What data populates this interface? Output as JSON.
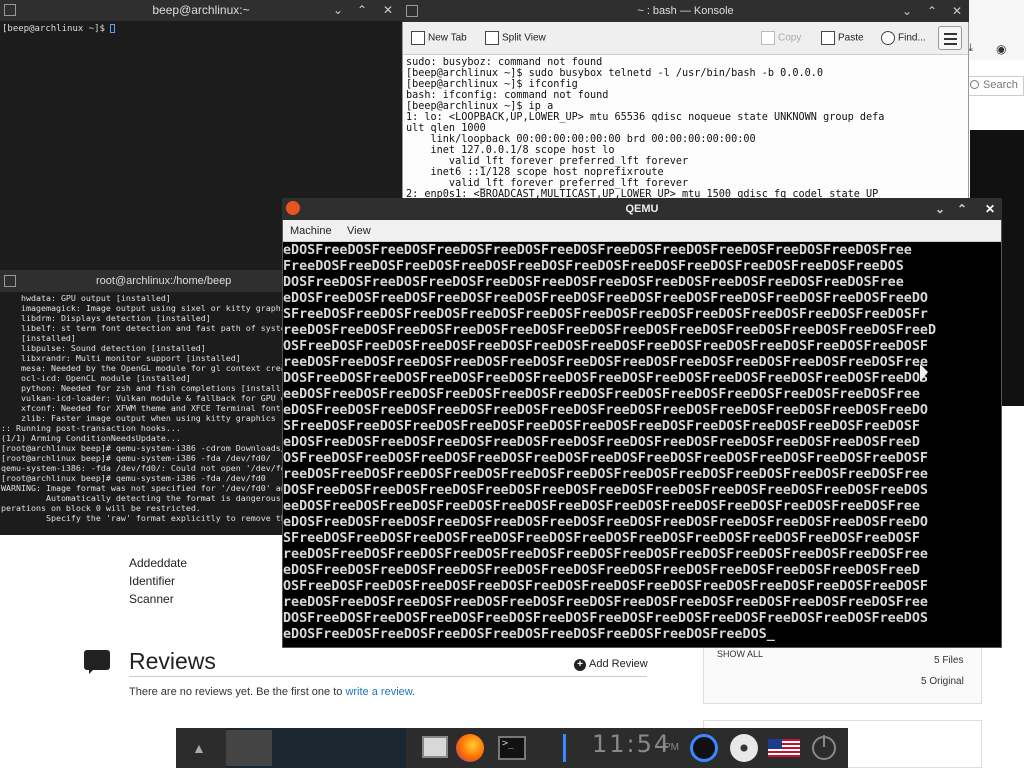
{
  "background_page": {
    "meta_items": [
      "Addeddate",
      "Identifier",
      "Scanner"
    ],
    "reviews_title": "Reviews",
    "add_review_label": "Add Review",
    "no_reviews_prefix": "There are no reviews yet. Be the first one to ",
    "no_reviews_link": "write a review",
    "no_reviews_suffix": ".",
    "show_all": "SHOW ALL",
    "files_count": "5 Files",
    "original_count": "5 Original",
    "search_placeholder": "Search"
  },
  "term1": {
    "title": "beep@archlinux:~",
    "prompt": "[beep@archlinux ~]$ "
  },
  "term2": {
    "title": "root@archlinux:/home/beep",
    "lines": [
      "    hwdata: GPU output [installed]",
      "    imagemagick: Image output using sixel or kitty graphi",
      "    libdrm: Displays detection [installed]",
      "    libelf: st term font detection and fast path of syste",
      "    [installed]",
      "    libpulse: Sound detection [installed]",
      "    libxrandr: Multi monitor support [installed]",
      "    mesa: Needed by the OpenGL module for gl context crea",
      "    ocl-icd: OpenCL module [installed]",
      "    python: Needed for zsh and fish completions [install",
      "    vulkan-icd-loader: Vulkan module & fallback for GPU o",
      "    xfconf: Needed for XFWM theme and XFCE Terminal font",
      "    zlib: Faster image output when using kitty graphics",
      ":: Running post-transaction hooks...",
      "(1/1) Arming ConditionNeedsUpdate...",
      "[root@archlinux beep]# qemu-system-i386 -cdrom Downloads/",
      "[root@archlinux beep]# qemu-system-i386 -fda /dev/fd0/",
      "qemu-system-i386: -fda /dev/fd0/: Could not open '/dev/fd",
      "[root@archlinux beep]# qemu-system-i386 -fda /dev/fd0",
      "WARNING: Image format was not specified for '/dev/fd0' an",
      "         Automatically detecting the format is dangerous",
      "perations on block 0 will be restricted.",
      "         Specify the 'raw' format explicitly to remove th"
    ]
  },
  "konsole": {
    "title": "~ : bash — Konsole",
    "toolbar": {
      "new_tab": "New Tab",
      "split_view": "Split View",
      "copy": "Copy",
      "paste": "Paste",
      "find": "Find..."
    },
    "lines": [
      "sudo: busyboz: command not found",
      "[beep@archlinux ~]$ sudo busybox telnetd -l /usr/bin/bash -b 0.0.0.0",
      "[beep@archlinux ~]$ ifconfig",
      "bash: ifconfig: command not found",
      "[beep@archlinux ~]$ ip a",
      "1: lo: <LOOPBACK,UP,LOWER_UP> mtu 65536 qdisc noqueue state UNKNOWN group defa",
      "ult qlen 1000",
      "    link/loopback 00:00:00:00:00:00 brd 00:00:00:00:00:00",
      "    inet 127.0.0.1/8 scope host lo",
      "       valid_lft forever preferred_lft forever",
      "    inet6 ::1/128 scope host noprefixroute",
      "       valid_lft forever preferred_lft forever",
      "2: enp0s1: <BROADCAST,MULTICAST,UP,LOWER_UP> mtu 1500 qdisc fq_codel state UP"
    ]
  },
  "qemu": {
    "title": "QEMU",
    "menu": [
      "Machine",
      "View"
    ],
    "screen_lines": [
      "eDOSFreeDOSFreeDOSFreeDOSFreeDOSFreeDOSFreeDOSFreeDOSFreeDOSFreeDOSFreeDOSFree",
      "FreeDOSFreeDOSFreeDOSFreeDOSFreeDOSFreeDOSFreeDOSFreeDOSFreeDOSFreeDOSFreeDOS",
      "DOSFreeDOSFreeDOSFreeDOSFreeDOSFreeDOSFreeDOSFreeDOSFreeDOSFreeDOSFreeDOSFree",
      "eDOSFreeDOSFreeDOSFreeDOSFreeDOSFreeDOSFreeDOSFreeDOSFreeDOSFreeDOSFreeDOSFreeDO",
      "SFreeDOSFreeDOSFreeDOSFreeDOSFreeDOSFreeDOSFreeDOSFreeDOSFreeDOSFreeDOSFreeDOSFr",
      "reeDOSFreeDOSFreeDOSFreeDOSFreeDOSFreeDOSFreeDOSFreeDOSFreeDOSFreeDOSFreeDOSFreeD",
      "OSFreeDOSFreeDOSFreeDOSFreeDOSFreeDOSFreeDOSFreeDOSFreeDOSFreeDOSFreeDOSFreeDOSF",
      "reeDOSFreeDOSFreeDOSFreeDOSFreeDOSFreeDOSFreeDOSFreeDOSFreeDOSFreeDOSFreeDOSFree",
      "DOSFreeDOSFreeDOSFreeDOSFreeDOSFreeDOSFreeDOSFreeDOSFreeDOSFreeDOSFreeDOSFreeDOS",
      "eeDOSFreeDOSFreeDOSFreeDOSFreeDOSFreeDOSFreeDOSFreeDOSFreeDOSFreeDOSFreeDOSFree",
      "eDOSFreeDOSFreeDOSFreeDOSFreeDOSFreeDOSFreeDOSFreeDOSFreeDOSFreeDOSFreeDOSFreeDO",
      "SFreeDOSFreeDOSFreeDOSFreeDOSFreeDOSFreeDOSFreeDOSFreeDOSFreeDOSFreeDOSFreeDOSF",
      "eDOSFreeDOSFreeDOSFreeDOSFreeDOSFreeDOSFreeDOSFreeDOSFreeDOSFreeDOSFreeDOSFreeD",
      "OSFreeDOSFreeDOSFreeDOSFreeDOSFreeDOSFreeDOSFreeDOSFreeDOSFreeDOSFreeDOSFreeDOSF",
      "reeDOSFreeDOSFreeDOSFreeDOSFreeDOSFreeDOSFreeDOSFreeDOSFreeDOSFreeDOSFreeDOSFree",
      "DOSFreeDOSFreeDOSFreeDOSFreeDOSFreeDOSFreeDOSFreeDOSFreeDOSFreeDOSFreeDOSFreeDOS",
      "eeDOSFreeDOSFreeDOSFreeDOSFreeDOSFreeDOSFreeDOSFreeDOSFreeDOSFreeDOSFreeDOSFree",
      "eDOSFreeDOSFreeDOSFreeDOSFreeDOSFreeDOSFreeDOSFreeDOSFreeDOSFreeDOSFreeDOSFreeDO",
      "SFreeDOSFreeDOSFreeDOSFreeDOSFreeDOSFreeDOSFreeDOSFreeDOSFreeDOSFreeDOSFreeDOSF",
      "reeDOSFreeDOSFreeDOSFreeDOSFreeDOSFreeDOSFreeDOSFreeDOSFreeDOSFreeDOSFreeDOSFree",
      "eDOSFreeDOSFreeDOSFreeDOSFreeDOSFreeDOSFreeDOSFreeDOSFreeDOSFreeDOSFreeDOSFreeD",
      "OSFreeDOSFreeDOSFreeDOSFreeDOSFreeDOSFreeDOSFreeDOSFreeDOSFreeDOSFreeDOSFreeDOSF",
      "reeDOSFreeDOSFreeDOSFreeDOSFreeDOSFreeDOSFreeDOSFreeDOSFreeDOSFreeDOSFreeDOSFree",
      "DOSFreeDOSFreeDOSFreeDOSFreeDOSFreeDOSFreeDOSFreeDOSFreeDOSFreeDOSFreeDOSFreeDOS",
      "eDOSFreeDOSFreeDOSFreeDOSFreeDOSFreeDOSFreeDOSFreeDOSFreeDOS_"
    ]
  },
  "taskbar": {
    "terminal_icon_text": ">_",
    "clock": "11:54",
    "clock_suffix": "PM"
  }
}
